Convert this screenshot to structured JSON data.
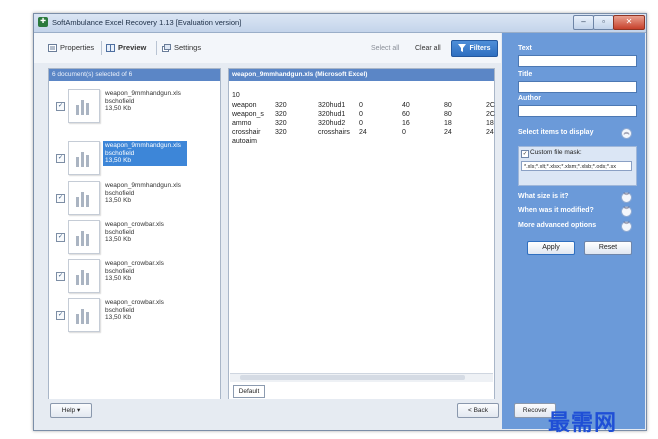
{
  "window": {
    "title": "SoftAmbulance Excel Recovery 1.13 [Evaluation version]"
  },
  "toolbar": {
    "properties": "Properties",
    "preview": "Preview",
    "settings": "Settings",
    "select_all": "Select all",
    "clear_all": "Clear all",
    "filters": "Filters"
  },
  "doclist": {
    "header": "6 document(s) selected of 6",
    "items": [
      {
        "name": "weapon_9mmhandgun.xls",
        "author": "bschofield",
        "size": "13,50 Kb"
      },
      {
        "name": "weapon_9mmhandgun.xls",
        "author": "bschofield",
        "size": "13,50 Kb"
      },
      {
        "name": "weapon_9mmhandgun.xls",
        "author": "bschofield",
        "size": "13,50 Kb"
      },
      {
        "name": "weapon_crowbar.xls",
        "author": "bschofield",
        "size": "13,50 Kb"
      },
      {
        "name": "weapon_crowbar.xls",
        "author": "bschofield",
        "size": "13,50 Kb"
      },
      {
        "name": "weapon_crowbar.xls",
        "author": "bschofield",
        "size": "13,50 Kb"
      }
    ]
  },
  "preview": {
    "header": "weapon_9mmhandgun.xls (Microsoft Excel)",
    "rows": [
      [
        "10",
        "",
        "",
        "",
        "",
        "",
        ""
      ],
      [
        "weapon",
        "320",
        "320hud1",
        "0",
        "40",
        "80",
        "2C"
      ],
      [
        "weapon_s",
        "320",
        "320hud1",
        "0",
        "60",
        "80",
        "2C"
      ],
      [
        "ammo",
        "320",
        "320hud2",
        "0",
        "16",
        "18",
        "18"
      ],
      [
        "crosshair",
        "320",
        "crosshairs",
        "24",
        "0",
        "24",
        "24"
      ],
      [
        "autoaim",
        "",
        "",
        "",
        "",
        "",
        ""
      ]
    ],
    "sheet_tab": "Default"
  },
  "filters": {
    "text_label": "Text",
    "title_label": "Title",
    "author_label": "Author",
    "select_items": "Select items to display",
    "custom_mask_label": "Custom file mask:",
    "custom_mask_value": "*.xls;*.xlt;*.xlsx;*.xlsm;*.xlsb;*.ods;*.sx",
    "what_size": "What size is it?",
    "when_modified": "When was it modified?",
    "more_options": "More advanced options",
    "apply": "Apply",
    "reset": "Reset"
  },
  "bottom": {
    "help": "Help",
    "back": "< Back",
    "recover": "Recover"
  },
  "watermark": "最需网",
  "colors": {
    "accent": "#5b86c6",
    "panel": "#6b9ad9",
    "selected": "#3d86d8"
  }
}
